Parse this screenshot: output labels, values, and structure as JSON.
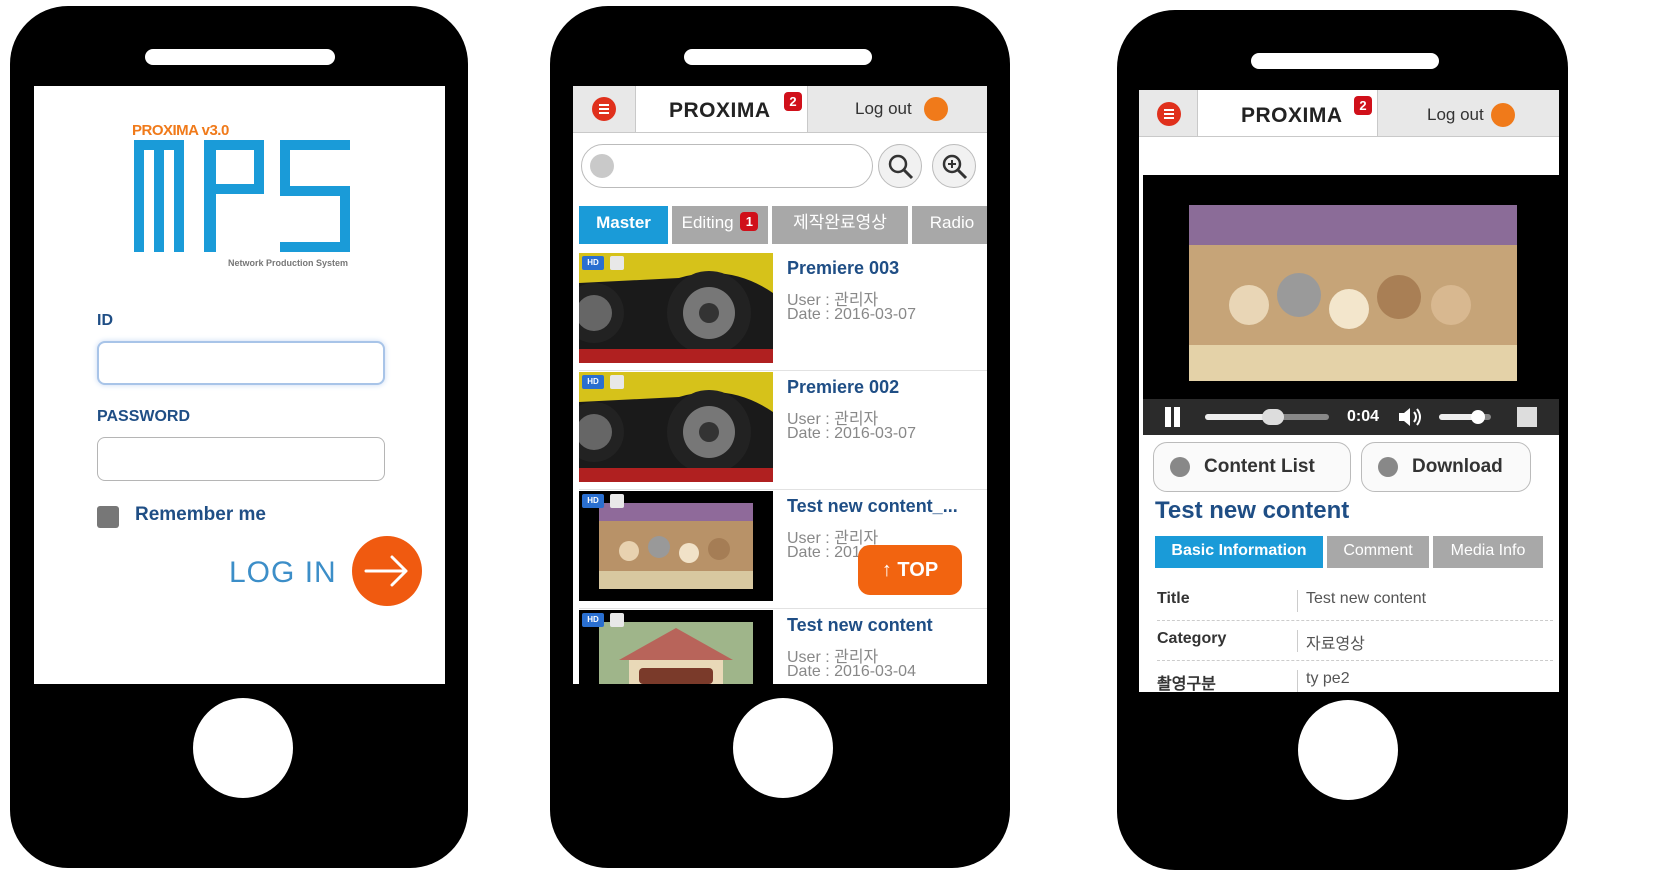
{
  "login": {
    "logo_version": "PROXIMA v3.0",
    "logo_sub": "Network Production System",
    "id_label": "ID",
    "id_value": "",
    "password_label": "PASSWORD",
    "password_value": "",
    "remember_label": "Remember me",
    "login_label": "LOG IN"
  },
  "header": {
    "brand": "PROXIMA",
    "notification_count": "2",
    "logout_label": "Log out"
  },
  "list": {
    "search_value": "",
    "tabs": [
      {
        "label": "Master",
        "badge": ""
      },
      {
        "label": "Editing",
        "badge": "1"
      },
      {
        "label": "제작완료영상",
        "badge": ""
      },
      {
        "label": "Radio",
        "badge": ""
      }
    ],
    "items": [
      {
        "title": "Premiere 003",
        "user": "User : 관리자",
        "date": "Date : 2016-03-07"
      },
      {
        "title": "Premiere 002",
        "user": "User : 관리자",
        "date": "Date : 2016-03-07"
      },
      {
        "title": "Test new content_...",
        "user": "User : 관리자",
        "date": "Date : 2016-03-04"
      },
      {
        "title": "Test new content",
        "user": "User : 관리자",
        "date": "Date : 2016-03-04"
      }
    ],
    "badge_hd": "HD",
    "top_button": "↑ TOP"
  },
  "detail": {
    "player": {
      "time": "0:04",
      "progress": 0.55,
      "volume": 0.75
    },
    "content_list_label": "Content List",
    "download_label": "Download",
    "title": "Test new content",
    "tabs": [
      "Basic Information",
      "Comment",
      "Media Info"
    ],
    "fields": [
      {
        "key": "Title",
        "value": "Test new content"
      },
      {
        "key": "Category",
        "value": "자료영상"
      },
      {
        "key": "촬영구분",
        "value": "ty pe2"
      }
    ]
  }
}
